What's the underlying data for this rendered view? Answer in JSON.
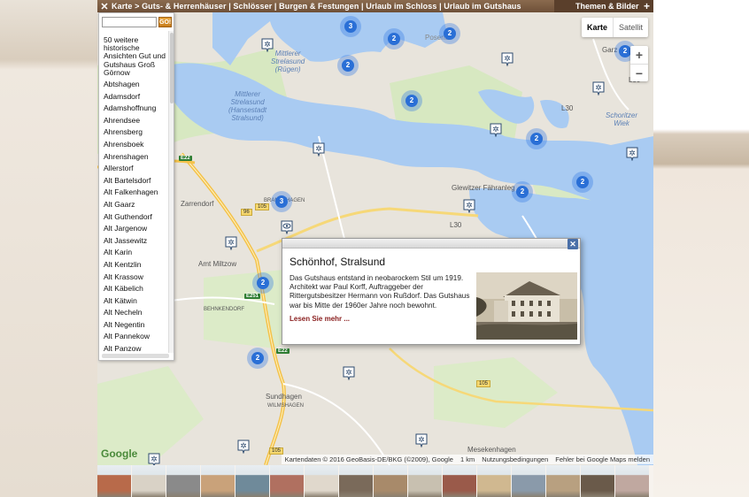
{
  "topbar": {
    "close_glyph": "✕",
    "breadcrumb": "Karte > Guts- & Herrenhäuser | Schlösser | Burgen & Festungen | Urlaub im Schloss | Urlaub im Gutshaus",
    "themes_label": "Themen & Bilder",
    "plus_glyph": "+"
  },
  "sidebar": {
    "search_value": "",
    "go_label": "GO!",
    "items": [
      "50 weitere historische Ansichten Gut und Gutshaus Groß Görnow",
      "Abtshagen",
      "Adamsdorf",
      "Adamshoffnung",
      "Ahrendsee",
      "Ahrensberg",
      "Ahrensboek",
      "Ahrenshagen",
      "Allerstorf",
      "Alt Bartelsdorf",
      "Alt Falkenhagen",
      "Alt Gaarz",
      "Alt Guthendorf",
      "Alt Jargenow",
      "Alt Jassewitz",
      "Alt Karin",
      "Alt Kentzlin",
      "Alt Krassow",
      "Alt Käbelich",
      "Alt Kätwin",
      "Alt Necheln",
      "Alt Negentin",
      "Alt Pannekow",
      "Alt Panzow"
    ]
  },
  "map": {
    "type_buttons": {
      "map": "Karte",
      "satellite": "Satellit"
    },
    "zoom_in": "+",
    "zoom_out": "−",
    "labels": {
      "mittlerer_strelasund_ruegen": "Mittlerer\nStrelasund\n(Rügen)",
      "mittlerer_strelasund_hst": "Mittlerer\nStrelasund\n(Hansestadt\nStralsund)",
      "schoritzer_wiek": "Schoritzer\nWiek",
      "glewitzer": "Glewitzer Fähranleg",
      "amt_miltzow": "Amt Miltzow",
      "zarrendorf": "Zarrendorf",
      "behnkendorf": "BEHNKENDORF",
      "sundhagen": "Sundhagen",
      "wilmshagen": "WILMSHAGEN",
      "mesekenhagen": "Mesekenhagen",
      "brandshagen": "BRANDSHAGEN",
      "garz": "Garz",
      "poseritz": "Poseritz"
    },
    "road_badges": [
      "E22",
      "E22",
      "E251",
      "E22"
    ],
    "road_numbers": [
      "105",
      "96",
      "105",
      "105"
    ],
    "road_small": [
      "L30",
      "L30",
      "L30"
    ],
    "clusters": [
      "3",
      "2",
      "2",
      "2",
      "2",
      "3",
      "2",
      "2",
      "2",
      "2",
      "2",
      "2"
    ],
    "google_logo": "Google",
    "attribution": {
      "data": "Kartendaten © 2016 GeoBasis-DE/BKG (©2009), Google",
      "scale": "1 km",
      "terms": "Nutzungsbedingungen",
      "report": "Fehler bei Google Maps melden"
    }
  },
  "info": {
    "title": "Schönhof, Stralsund",
    "description": "Das Gutshaus entstand in neobarockem Stil um 1919. Architekt war Paul Korff, Auftraggeber der Rittergutsbesitzer Hermann von Rußdorf. Das Gutshaus war bis Mitte der 1960er Jahre noch bewohnt.",
    "more_link": "Lesen Sie mehr ...",
    "close_glyph": "✕"
  },
  "colors": {
    "water": "#a9cbf2",
    "land": "#e8e4dc",
    "green": "#cfe3b6",
    "cluster": "#2a6fd6",
    "topbar": "#7a5a40",
    "link": "#8b2020"
  },
  "thumbs_count": 16
}
